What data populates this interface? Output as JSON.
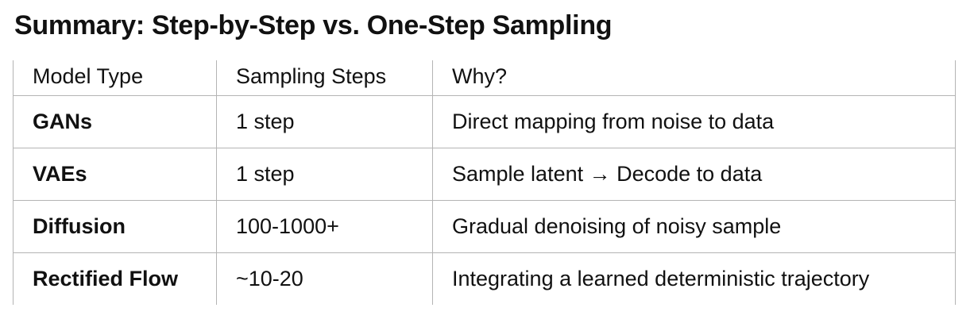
{
  "title": "Summary: Step-by-Step vs. One-Step Sampling",
  "table": {
    "headers": [
      "Model Type",
      "Sampling Steps",
      "Why?"
    ],
    "rows": [
      {
        "model": "GANs",
        "steps": "1 step",
        "why": "Direct mapping from noise to data"
      },
      {
        "model": "VAEs",
        "steps": "1 step",
        "why": "Sample latent → Decode to data"
      },
      {
        "model": "Diffusion",
        "steps": "100-1000+",
        "why": "Gradual denoising of noisy sample"
      },
      {
        "model": "Rectified Flow",
        "steps": "~10-20",
        "why": "Integrating a learned deterministic trajectory"
      }
    ]
  }
}
